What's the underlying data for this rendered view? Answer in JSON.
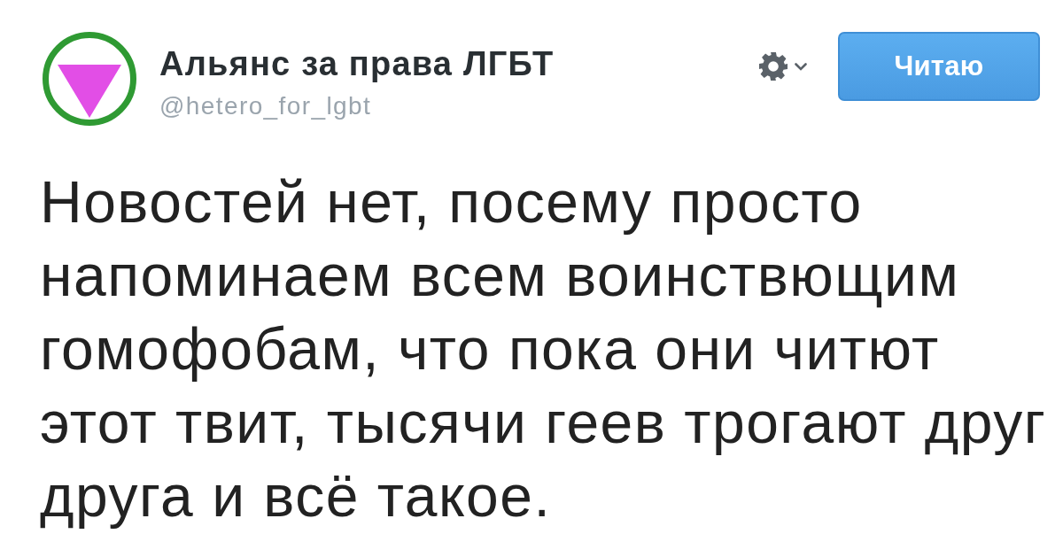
{
  "account": {
    "name": "Альянс за права ЛГБТ",
    "handle": "@hetero_for_lgbt"
  },
  "follow_button": {
    "label": "Читаю",
    "following": true
  },
  "tweet": {
    "text": "Новостей нет, посему просто напоминаем всем воинствющим гомофобам, что пока они читют этот твит, тысячи геев трогают друг друга и всё такое."
  }
}
